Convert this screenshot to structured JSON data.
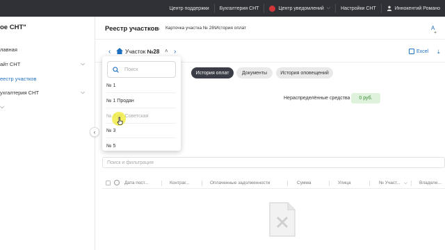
{
  "topbar": {
    "support": "Центр поддержки",
    "accounting": "Бухгалтерия СНТ",
    "notifications": "Центр уведомлений",
    "settings": "Настройки СНТ",
    "user": "Иннокентий Романо"
  },
  "sidebar": {
    "brand": "ое СНТ\"",
    "items": [
      {
        "label": "лавная"
      },
      {
        "label": "айт СНТ"
      },
      {
        "label": "еестр участков"
      },
      {
        "label": "ухгалтерия СНТ"
      }
    ]
  },
  "header": {
    "title": "Реестр участков",
    "breadcrumb": "Карточка участка № 28\\История оплат",
    "right_letter": "A"
  },
  "plot": {
    "label_prefix": "Участок ",
    "label_number": "№28"
  },
  "toolbar": {
    "excel": "Excel"
  },
  "tabs": [
    {
      "label": "История оплат",
      "active": true
    },
    {
      "label": "Документы",
      "active": false
    },
    {
      "label": "История оповещений",
      "active": false
    }
  ],
  "balance": {
    "label": "Нераспределённые средства",
    "value": "0 руб."
  },
  "search_filter": {
    "placeholder": "Поиск и фильтрация"
  },
  "table": {
    "columns": [
      "Дата пост...",
      "Контраг...",
      "Оплаченные задолженности",
      "Сумма",
      "Улица",
      "№ Участ...",
      "Владеле..."
    ]
  },
  "dropdown": {
    "search_placeholder": "Поиск",
    "items": [
      {
        "label": "№ 1"
      },
      {
        "label": "№ 1 Продан"
      },
      {
        "label": "№ 2 ул. Советская"
      },
      {
        "label": "№ 3"
      },
      {
        "label": "№ 5"
      }
    ]
  },
  "colors": {
    "accent": "#1f6fbf",
    "topbar": "#2f3136",
    "tab_active": "#3a3d45",
    "money_bg": "#dff3dc"
  }
}
